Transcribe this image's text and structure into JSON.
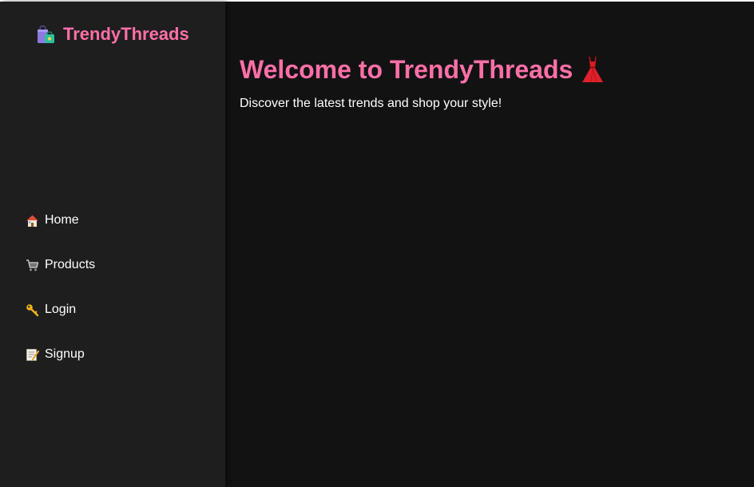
{
  "brand": {
    "name": "TrendyThreads",
    "icon": "shopping-bags-icon"
  },
  "nav": {
    "items": [
      {
        "label": "Home",
        "icon": "house-icon"
      },
      {
        "label": "Products",
        "icon": "shopping-cart-icon"
      },
      {
        "label": "Login",
        "icon": "key-icon"
      },
      {
        "label": "Signup",
        "icon": "memo-icon"
      }
    ]
  },
  "main": {
    "title": "Welcome to TrendyThreads",
    "title_icon": "dress-icon",
    "subtitle": "Discover the latest trends and shop your style!"
  },
  "colors": {
    "background": "#121212",
    "sidebar": "#1e1e1e",
    "accent": "#ff6fa8",
    "text": "#ffffff"
  }
}
